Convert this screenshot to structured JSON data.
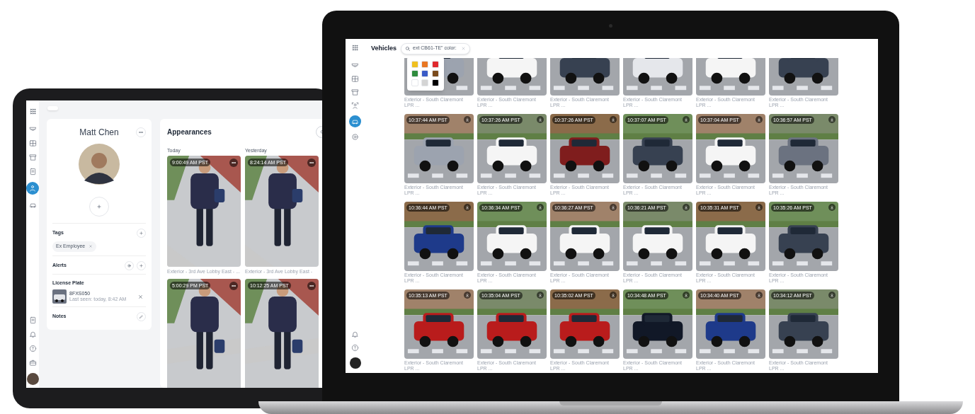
{
  "tablet": {
    "sidebar": {
      "items": [
        {
          "selected": false
        },
        {
          "selected": false
        },
        {
          "selected": false
        },
        {
          "selected": false
        },
        {
          "selected": true
        },
        {
          "selected": false
        }
      ]
    },
    "profile": {
      "name": "Matt Chen",
      "tags_title": "Tags",
      "tags": [
        {
          "label": "Ex Employee"
        }
      ],
      "alerts_title": "Alerts",
      "license_plate_title": "License Plate",
      "plate": {
        "number": "8FXS050",
        "last_seen": "Last seen: today, 8:42 AM"
      },
      "notes_title": "Notes"
    },
    "appearances": {
      "title": "Appearances",
      "columns": [
        {
          "label": "Today",
          "items": [
            {
              "time": "9:00:49 AM PST",
              "caption": "Exterior - 3rd Ave Lobby East - ..."
            },
            {
              "time": "5:00:29 PM PST"
            }
          ]
        },
        {
          "label": "Yesterday",
          "items": [
            {
              "time": "8:24:14 AM PST",
              "caption": "Exterior - 3rd Ave Lobby East -"
            },
            {
              "time": "10:12:25 AM PST"
            }
          ]
        }
      ]
    }
  },
  "laptop": {
    "sidebar": {
      "items": [
        {
          "selected": false
        },
        {
          "selected": false
        },
        {
          "selected": false
        },
        {
          "selected": false
        },
        {
          "selected": true
        },
        {
          "selected": false
        }
      ]
    },
    "title": "Vehicles",
    "search": {
      "value": "ext CB61-TE\" color:"
    },
    "color_palette": [
      {
        "color": "#f0c020"
      },
      {
        "color": "#e87722"
      },
      {
        "color": "#e0282e"
      },
      {
        "color": "#2e8b3e"
      },
      {
        "color": "#3a5bc7"
      },
      {
        "color": "#7a4a1c"
      },
      {
        "color": "#ffffff"
      },
      {
        "color": "#d4d4d4"
      },
      {
        "color": "#000000"
      }
    ],
    "rows": [
      [
        {
          "caption": "Exterior - South Claremont LPR ..."
        },
        {
          "caption": "Exterior - South Claremont LPR ..."
        },
        {
          "caption": "Exterior - South Claremont LPR ..."
        },
        {
          "caption": "Exterior - South Claremont LPR ..."
        },
        {
          "caption": "Exterior - South Claremont LPR ..."
        },
        {
          "caption": "Exterior - South Claremont LPR ..."
        }
      ],
      [
        {
          "time": "10:37:44 AM PST",
          "caption": "Exterior - South Claremont LPR ..."
        },
        {
          "time": "10:37:26 AM PST",
          "caption": "Exterior - South Claremont LPR ..."
        },
        {
          "time": "10:37:26 AM PST",
          "caption": "Exterior - South Claremont LPR ..."
        },
        {
          "time": "10:37:07 AM PST",
          "caption": "Exterior - South Claremont LPR ..."
        },
        {
          "time": "10:37:04 AM PST",
          "caption": "Exterior - South Claremont LPR ..."
        },
        {
          "time": "10:36:57 AM PST",
          "caption": "Exterior - South Claremont LPR ..."
        }
      ],
      [
        {
          "time": "10:36:44 AM PST",
          "caption": "Exterior - South Claremont LPR ..."
        },
        {
          "time": "10:36:34 AM PST",
          "caption": "Exterior - South Claremont LPR ..."
        },
        {
          "time": "10:36:27 AM PST",
          "caption": "Exterior - South Claremont LPR ..."
        },
        {
          "time": "10:36:21 AM PST",
          "caption": "Exterior - South Claremont LPR ..."
        },
        {
          "time": "10:35:31 AM PST",
          "caption": "Exterior - South Claremont LPR ..."
        },
        {
          "time": "10:35:26 AM PST",
          "caption": "Exterior - South Claremont LPR ..."
        }
      ],
      [
        {
          "time": "10:35:13 AM PST",
          "caption": "Exterior - South Claremont LPR ..."
        },
        {
          "time": "10:35:04 AM PST",
          "caption": "Exterior - South Claremont LPR ..."
        },
        {
          "time": "10:35:02 AM PST",
          "caption": "Exterior - South Claremont LPR ..."
        },
        {
          "time": "10:34:48 AM PST",
          "caption": "Exterior - South Claremont LPR ..."
        },
        {
          "time": "10:34:40 AM PST",
          "caption": "Exterior - South Claremont LPR ..."
        },
        {
          "time": "10:34:12 AM PST",
          "caption": "Exterior - South Claremont LPR ..."
        }
      ]
    ]
  }
}
